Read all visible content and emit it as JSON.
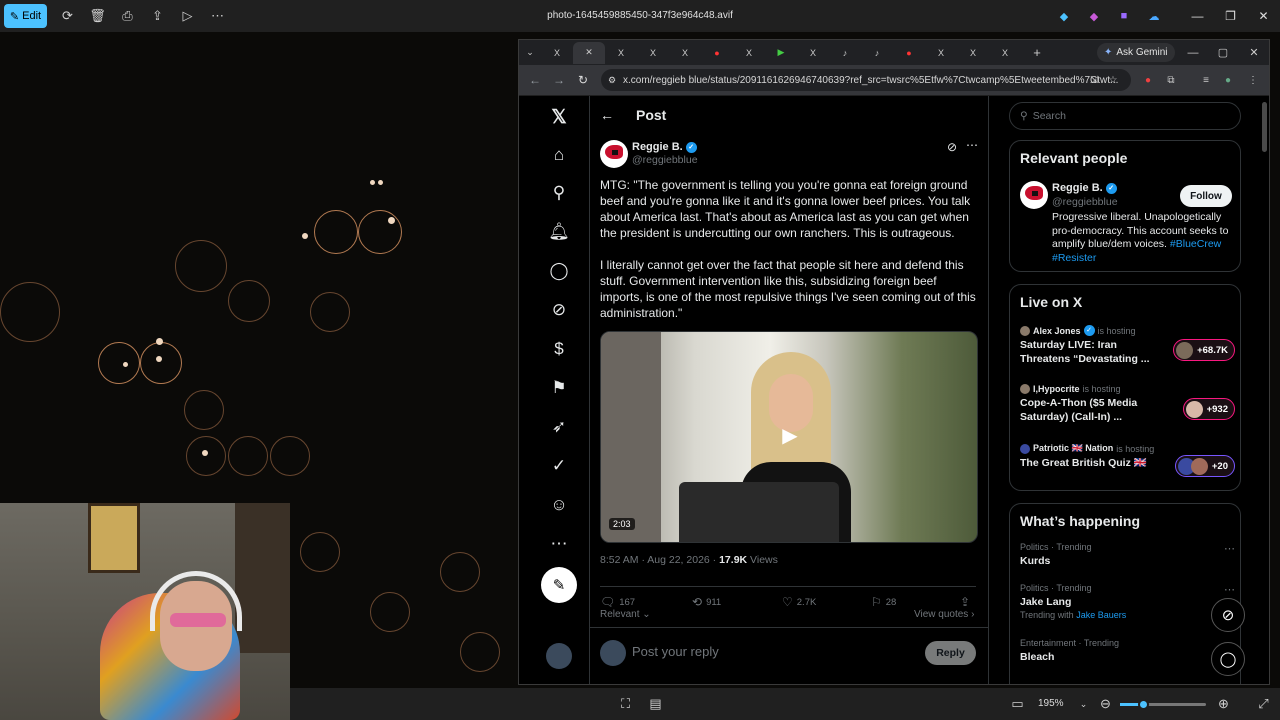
{
  "photos_app": {
    "edit_label": "Edit",
    "file_name": "photo-1645459885450-347f3e964c48.avif",
    "zoom": "195%",
    "toolbar_icons": [
      "rotate-icon",
      "delete-icon",
      "print-icon",
      "share-icon",
      "slideshow-icon",
      "more-icon"
    ]
  },
  "browser": {
    "ask_gemini": "Ask Gemini",
    "url": "x.com/reggieb blue/status/2091161626946740639?ref_src=twsrc%5Etfw%7Ctwcamp%5Etweetembed%7Ctwt...",
    "tab_glyphs": [
      "X",
      "X",
      "X",
      "X",
      "X",
      "▶",
      "X",
      "▶",
      "X",
      "♪",
      "X",
      "▶",
      "X",
      "X",
      "X"
    ]
  },
  "post": {
    "header": "Post",
    "author_name": "Reggie B.",
    "author_handle": "@reggiebblue",
    "text": "MTG: \"The government is telling you you're gonna eat foreign ground beef and you're gonna like it and it's gonna lower beef prices. You talk about America last. That's about as America last as you can get when the president is undercutting our own ranchers. This is outrageous.\n\nI literally cannot get over the fact that people sit here and defend this stuff. Government intervention like this, subsidizing foreign beef imports, is one of the most repulsive things I've seen coming out of this administration.\"",
    "video_duration": "2:03",
    "timestamp": "8:52 AM · Aug 22, 2026 · ",
    "views_count": "17.9K",
    "views_label": " Views",
    "replies": "167",
    "reposts": "911",
    "likes": "2.7K",
    "bookmarks": "28",
    "relevant": "Relevant",
    "view_quotes": "View quotes",
    "reply_placeholder": "Post your reply",
    "reply_button": "Reply"
  },
  "sidebar": {
    "search_placeholder": "Search",
    "relevant_people": {
      "title": "Relevant people",
      "name": "Reggie B.",
      "handle": "@reggiebblue",
      "follow": "Follow",
      "bio": "Progressive liberal. Unapologetically pro-democracy. This account seeks to amplify blue/dem voices. ",
      "tag1": "#BlueCrew",
      "tag2": "#Resister"
    },
    "live": {
      "title": "Live on X",
      "items": [
        {
          "host": "Alex Jones",
          "hosting": "is hosting",
          "title": "Saturday LIVE: Iran Threatens “Devastating ...",
          "count": "+68.7K"
        },
        {
          "host": "I,Hypocrite",
          "hosting": "is hosting",
          "title": "Cope-A-Thon ($5 Media Saturday) (Call-In) ...",
          "count": "+932"
        },
        {
          "host": "Patriotic 🇬🇧 Nation",
          "hosting": "is hosting",
          "title": "The Great British Quiz 🇬🇧",
          "count": "+20"
        }
      ]
    },
    "happening": {
      "title": "What’s happening",
      "items": [
        {
          "category": "Politics · Trending",
          "name": "Kurds",
          "with_label": "",
          "with": ""
        },
        {
          "category": "Politics · Trending",
          "name": "Jake Lang",
          "with_label": "Trending with ",
          "with": "Jake Bauers"
        },
        {
          "category": "Entertainment · Trending",
          "name": "Bleach",
          "with_label": "",
          "with": ""
        }
      ]
    }
  },
  "colors": {
    "accent": "#1d9bf0",
    "edit_button": "#4cc2ff",
    "live_border": "#f91880",
    "live_border_alt": "#7856ff"
  }
}
